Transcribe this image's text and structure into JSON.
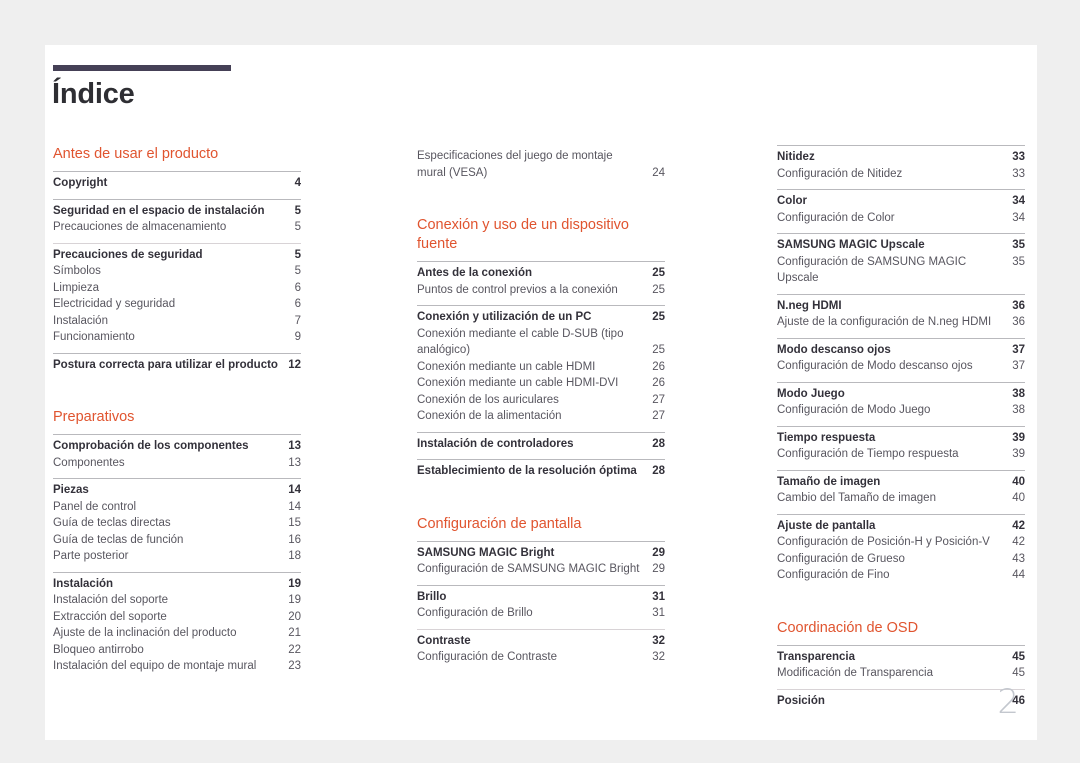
{
  "document": {
    "title": "Índice",
    "folio": "2"
  },
  "colors": {
    "accent": "#e0542f",
    "title_bar": "#454056",
    "text": "#58565f",
    "heading_text": "#33313a",
    "rule": "#b9b9bd",
    "folio": "#c3c7ce",
    "page_background": "#ffffff",
    "canvas_background": "#efefef"
  },
  "columns": [
    {
      "blocks": [
        {
          "kind": "section",
          "title": "Antes de usar el producto",
          "groups": [
            {
              "rule": "solid",
              "rows": [
                {
                  "type": "head",
                  "label": "Copyright",
                  "page": "4"
                }
              ]
            },
            {
              "rule": "solid",
              "rows": [
                {
                  "type": "head",
                  "label": "Seguridad en el espacio de instalación",
                  "page": "5"
                },
                {
                  "type": "sub",
                  "label": "Precauciones de almacenamiento",
                  "page": "5"
                }
              ]
            },
            {
              "rule": "faint",
              "rows": [
                {
                  "type": "head",
                  "label": "Precauciones de seguridad",
                  "page": "5"
                },
                {
                  "type": "sub",
                  "label": "Símbolos",
                  "page": "5"
                },
                {
                  "type": "sub",
                  "label": "Limpieza",
                  "page": "6"
                },
                {
                  "type": "sub",
                  "label": "Electricidad y seguridad",
                  "page": "6"
                },
                {
                  "type": "sub",
                  "label": "Instalación",
                  "page": "7"
                },
                {
                  "type": "sub",
                  "label": "Funcionamiento",
                  "page": "9"
                }
              ]
            },
            {
              "rule": "solid",
              "rows": [
                {
                  "type": "head",
                  "label": "Postura correcta para utilizar el producto",
                  "page": "12"
                }
              ]
            }
          ]
        },
        {
          "kind": "section",
          "title": "Preparativos",
          "spacer_before": true,
          "groups": [
            {
              "rule": "solid",
              "rows": [
                {
                  "type": "head",
                  "label": "Comprobación de los componentes",
                  "page": "13"
                },
                {
                  "type": "sub",
                  "label": "Componentes",
                  "page": "13"
                }
              ]
            },
            {
              "rule": "solid",
              "rows": [
                {
                  "type": "head",
                  "label": "Piezas",
                  "page": "14"
                },
                {
                  "type": "sub",
                  "label": "Panel de control",
                  "page": "14"
                },
                {
                  "type": "sub",
                  "label": "Guía de teclas directas",
                  "page": "15"
                },
                {
                  "type": "sub",
                  "label": "Guía de teclas de función",
                  "page": "16"
                },
                {
                  "type": "sub",
                  "label": "Parte posterior",
                  "page": "18"
                }
              ]
            },
            {
              "rule": "solid",
              "rows": [
                {
                  "type": "head",
                  "label": "Instalación",
                  "page": "19"
                },
                {
                  "type": "sub",
                  "label": "Instalación del soporte",
                  "page": "19"
                },
                {
                  "type": "sub",
                  "label": "Extracción del soporte",
                  "page": "20"
                },
                {
                  "type": "sub",
                  "label": "Ajuste de la inclinación del producto",
                  "page": "21"
                },
                {
                  "type": "sub",
                  "label": "Bloqueo antirrobo",
                  "page": "22"
                },
                {
                  "type": "sub",
                  "label": "Instalación del equipo de montaje mural",
                  "page": "23"
                }
              ]
            }
          ]
        }
      ]
    },
    {
      "blocks": [
        {
          "kind": "continuation",
          "groups": [
            {
              "rule": "none",
              "rows": [
                {
                  "type": "sub-wrap",
                  "label": "Especificaciones del juego de montaje mural (VESA)",
                  "page": "24"
                }
              ]
            }
          ]
        },
        {
          "kind": "section",
          "title": "Conexión y uso de un dispositivo fuente",
          "spacer_before": true,
          "groups": [
            {
              "rule": "solid",
              "rows": [
                {
                  "type": "head",
                  "label": "Antes de la conexión",
                  "page": "25"
                },
                {
                  "type": "sub",
                  "label": "Puntos de control previos a la conexión",
                  "page": "25"
                }
              ]
            },
            {
              "rule": "solid",
              "rows": [
                {
                  "type": "head",
                  "label": "Conexión y utilización de un PC",
                  "page": "25"
                },
                {
                  "type": "sub-wrap",
                  "label": "Conexión mediante el cable D-SUB (tipo analógico)",
                  "page": "25"
                },
                {
                  "type": "sub",
                  "label": "Conexión mediante un cable HDMI",
                  "page": "26"
                },
                {
                  "type": "sub",
                  "label": "Conexión mediante un cable HDMI-DVI",
                  "page": "26"
                },
                {
                  "type": "sub",
                  "label": "Conexión de los auriculares",
                  "page": "27"
                },
                {
                  "type": "sub",
                  "label": "Conexión de la alimentación",
                  "page": "27"
                }
              ]
            },
            {
              "rule": "solid",
              "rows": [
                {
                  "type": "head",
                  "label": "Instalación de controladores",
                  "page": "28"
                }
              ]
            },
            {
              "rule": "solid",
              "rows": [
                {
                  "type": "head",
                  "label": "Establecimiento de la resolución óptima",
                  "page": "28"
                }
              ]
            }
          ]
        },
        {
          "kind": "section",
          "title": "Configuración de pantalla",
          "spacer_before": true,
          "groups": [
            {
              "rule": "solid",
              "rows": [
                {
                  "type": "head",
                  "label": "SAMSUNG MAGIC Bright",
                  "page": "29"
                },
                {
                  "type": "sub",
                  "label": "Configuración de SAMSUNG MAGIC Bright",
                  "page": "29"
                }
              ]
            },
            {
              "rule": "solid",
              "rows": [
                {
                  "type": "head",
                  "label": "Brillo",
                  "page": "31"
                },
                {
                  "type": "sub",
                  "label": "Configuración de Brillo",
                  "page": "31"
                }
              ]
            },
            {
              "rule": "faint",
              "rows": [
                {
                  "type": "head",
                  "label": "Contraste",
                  "page": "32"
                },
                {
                  "type": "sub",
                  "label": "Configuración de Contraste",
                  "page": "32"
                }
              ]
            }
          ]
        }
      ]
    },
    {
      "blocks": [
        {
          "kind": "continuation",
          "groups": [
            {
              "rule": "solid",
              "rows": [
                {
                  "type": "head",
                  "label": "Nitidez",
                  "page": "33"
                },
                {
                  "type": "sub",
                  "label": "Configuración de Nitidez",
                  "page": "33"
                }
              ]
            },
            {
              "rule": "solid",
              "rows": [
                {
                  "type": "head",
                  "label": "Color",
                  "page": "34"
                },
                {
                  "type": "sub",
                  "label": "Configuración de Color",
                  "page": "34"
                }
              ]
            },
            {
              "rule": "solid",
              "rows": [
                {
                  "type": "head",
                  "label": "SAMSUNG MAGIC Upscale",
                  "page": "35"
                },
                {
                  "type": "sub",
                  "label": "Configuración de SAMSUNG MAGIC Upscale",
                  "page": "35"
                }
              ]
            },
            {
              "rule": "solid",
              "rows": [
                {
                  "type": "head",
                  "label": "N.neg HDMI",
                  "page": "36"
                },
                {
                  "type": "sub",
                  "label": "Ajuste de la configuración de N.neg HDMI",
                  "page": "36"
                }
              ]
            },
            {
              "rule": "solid",
              "rows": [
                {
                  "type": "head",
                  "label": "Modo descanso ojos",
                  "page": "37"
                },
                {
                  "type": "sub",
                  "label": "Configuración de Modo descanso ojos",
                  "page": "37"
                }
              ]
            },
            {
              "rule": "solid",
              "rows": [
                {
                  "type": "head",
                  "label": "Modo Juego",
                  "page": "38"
                },
                {
                  "type": "sub",
                  "label": "Configuración de Modo Juego",
                  "page": "38"
                }
              ]
            },
            {
              "rule": "solid",
              "rows": [
                {
                  "type": "head",
                  "label": "Tiempo respuesta",
                  "page": "39"
                },
                {
                  "type": "sub",
                  "label": "Configuración de Tiempo respuesta",
                  "page": "39"
                }
              ]
            },
            {
              "rule": "solid",
              "rows": [
                {
                  "type": "head",
                  "label": "Tamaño de imagen",
                  "page": "40"
                },
                {
                  "type": "sub",
                  "label": "Cambio del Tamaño de imagen",
                  "page": "40"
                }
              ]
            },
            {
              "rule": "solid",
              "rows": [
                {
                  "type": "head",
                  "label": "Ajuste de pantalla",
                  "page": "42"
                },
                {
                  "type": "sub",
                  "label": "Configuración de Posición-H y Posición-V",
                  "page": "42"
                },
                {
                  "type": "sub",
                  "label": "Configuración de Grueso",
                  "page": "43"
                },
                {
                  "type": "sub",
                  "label": "Configuración de Fino",
                  "page": "44"
                }
              ]
            }
          ]
        },
        {
          "kind": "section",
          "title": "Coordinación de OSD",
          "spacer_before": true,
          "groups": [
            {
              "rule": "solid",
              "rows": [
                {
                  "type": "head",
                  "label": "Transparencia",
                  "page": "45"
                },
                {
                  "type": "sub",
                  "label": "Modificación de Transparencia",
                  "page": "45"
                }
              ]
            },
            {
              "rule": "faint",
              "rows": [
                {
                  "type": "head",
                  "label": "Posición",
                  "page": "46"
                }
              ]
            }
          ]
        }
      ]
    }
  ]
}
